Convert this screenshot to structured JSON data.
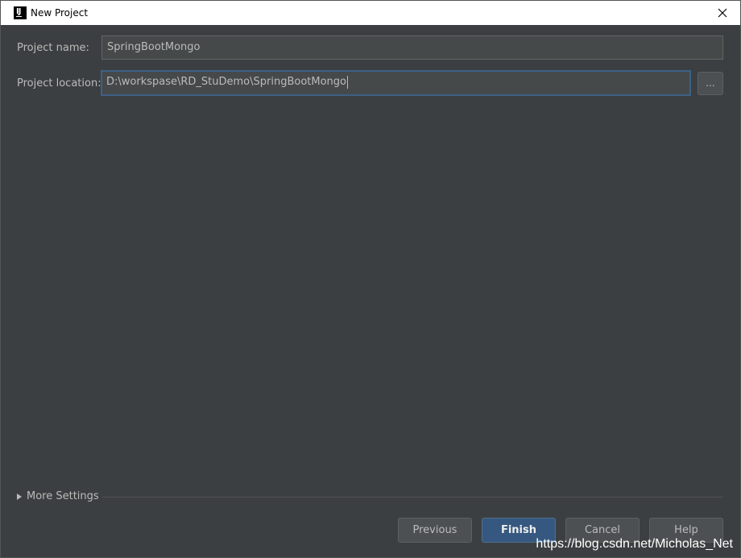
{
  "window": {
    "title": "New Project",
    "app_icon": "intellij-icon",
    "close_icon": "close-icon"
  },
  "form": {
    "project_name_label": "Project name:",
    "project_name_value": "SpringBootMongo",
    "project_location_label": "Project location:",
    "project_location_value": "D:\\workspase\\RD_StuDemo\\SpringBootMongo",
    "browse_label": "..."
  },
  "more_settings": {
    "label": "More Settings",
    "expanded": false
  },
  "buttons": {
    "previous": "Previous",
    "finish": "Finish",
    "cancel": "Cancel",
    "help": "Help"
  },
  "watermark": "https://blog.csdn.net/Micholas_Net",
  "colors": {
    "background": "#3c3f41",
    "field": "#45494a",
    "focus_border": "#3d6185",
    "primary_button": "#365880",
    "text": "#bbbbbb"
  }
}
